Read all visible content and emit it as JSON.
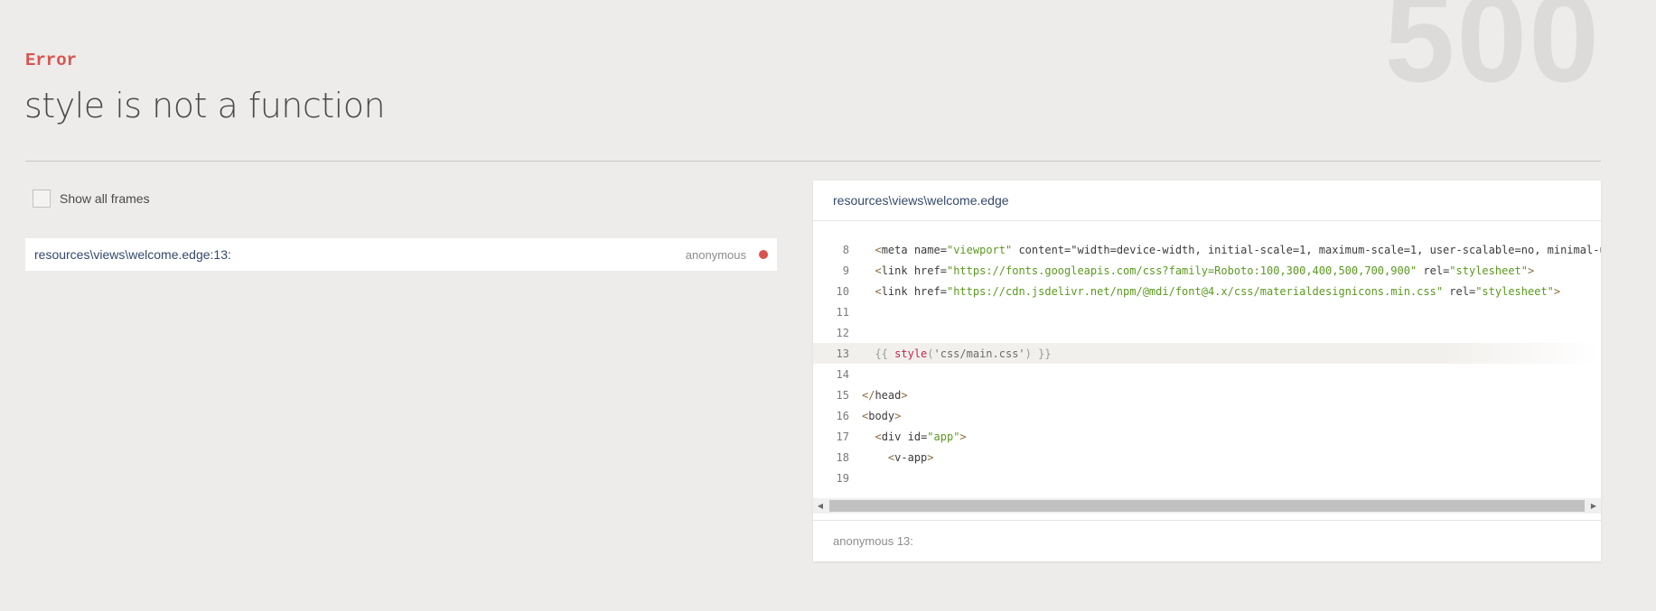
{
  "status_code": "500",
  "error": {
    "label": "Error",
    "message": "style is not a function"
  },
  "frames_toggle": {
    "label": "Show all frames",
    "checked": false
  },
  "frames": [
    {
      "file": "resources\\views\\welcome.edge:13:",
      "method": "anonymous"
    }
  ],
  "code_panel": {
    "file": "resources\\views\\welcome.edge",
    "highlighted_line": 13,
    "lines": [
      {
        "no": "8",
        "text": "  <meta name=\"viewport\" content=\"width=device-width, initial-scale=1, maximum-scale=1, user-scalable=no, minimal-ui"
      },
      {
        "no": "9",
        "text": "  <link href=\"https://fonts.googleapis.com/css?family=Roboto:100,300,400,500,700,900\" rel=\"stylesheet\">"
      },
      {
        "no": "10",
        "text": "  <link href=\"https://cdn.jsdelivr.net/npm/@mdi/font@4.x/css/materialdesignicons.min.css\" rel=\"stylesheet\">"
      },
      {
        "no": "11",
        "text": ""
      },
      {
        "no": "12",
        "text": ""
      },
      {
        "no": "13",
        "text": "  {{ style('css/main.css') }}"
      },
      {
        "no": "14",
        "text": ""
      },
      {
        "no": "15",
        "text": "</head>"
      },
      {
        "no": "16",
        "text": "<body>"
      },
      {
        "no": "17",
        "text": "  <div id=\"app\">"
      },
      {
        "no": "18",
        "text": "    <v-app>"
      },
      {
        "no": "19",
        "text": ""
      }
    ],
    "footer": "anonymous 13:"
  },
  "colors": {
    "accent_error": "#d9534f",
    "background": "#edecea",
    "file_link": "#34496b",
    "attr_value": "#5a9a1e"
  }
}
